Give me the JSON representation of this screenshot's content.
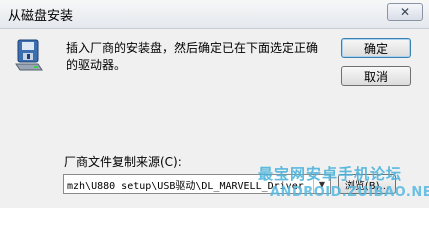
{
  "window": {
    "title": "从磁盘安装",
    "close_glyph": "✕"
  },
  "message": "插入厂商的安装盘，然后确定已在下面选定正确的驱动器。",
  "buttons": {
    "ok": "确定",
    "cancel": "取消",
    "browse": "浏览(B)..."
  },
  "source": {
    "label": "厂商文件复制来源(C):",
    "value": "mzh\\U880 setup\\USB驱动\\DL_MARVELL_Driver"
  },
  "watermark": {
    "line1": "最宝网安卓手机论坛",
    "line2": "ANDROID.ZUIBAO.NET"
  }
}
